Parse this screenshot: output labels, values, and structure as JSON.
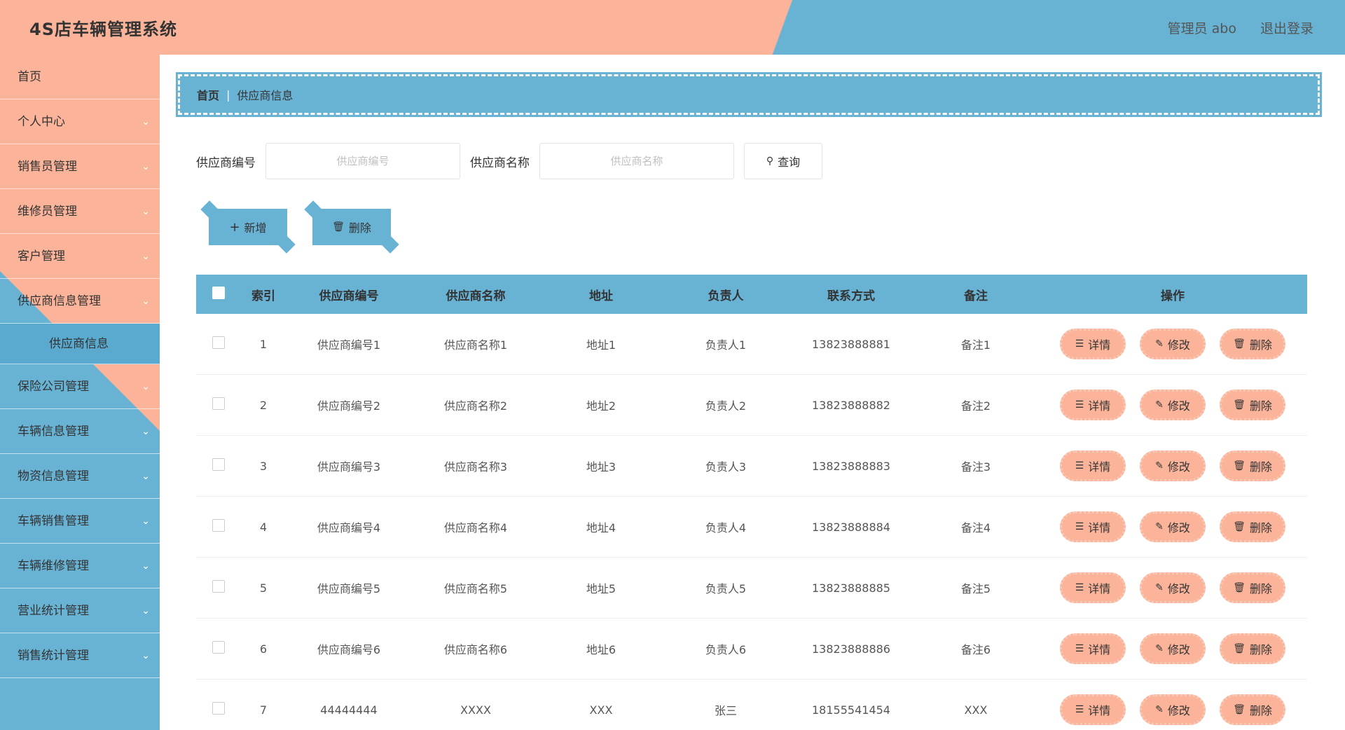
{
  "header": {
    "title": "4S店车辆管理系统",
    "admin": "管理员 abo",
    "logout": "退出登录"
  },
  "sidebar": {
    "items": [
      {
        "label": "首页",
        "chevron": false
      },
      {
        "label": "个人中心",
        "chevron": true
      },
      {
        "label": "销售员管理",
        "chevron": true
      },
      {
        "label": "维修员管理",
        "chevron": true
      },
      {
        "label": "客户管理",
        "chevron": true
      },
      {
        "label": "供应商信息管理",
        "chevron": true
      },
      {
        "label": "供应商信息",
        "chevron": false,
        "sub": true
      },
      {
        "label": "保险公司管理",
        "chevron": true
      },
      {
        "label": "车辆信息管理",
        "chevron": true
      },
      {
        "label": "物资信息管理",
        "chevron": true
      },
      {
        "label": "车辆销售管理",
        "chevron": true
      },
      {
        "label": "车辆维修管理",
        "chevron": true
      },
      {
        "label": "营业统计管理",
        "chevron": true
      },
      {
        "label": "销售统计管理",
        "chevron": true
      }
    ]
  },
  "breadcrumb": {
    "home": "首页",
    "sep": "|",
    "current": "供应商信息"
  },
  "search": {
    "no_label": "供应商编号",
    "no_placeholder": "供应商编号",
    "name_label": "供应商名称",
    "name_placeholder": "供应商名称",
    "query_label": "查询",
    "query_icon": "search-icon"
  },
  "actions": {
    "add_label": "新增",
    "delete_label": "删除"
  },
  "table": {
    "headers": [
      "索引",
      "供应商编号",
      "供应商名称",
      "地址",
      "负责人",
      "联系方式",
      "备注",
      "操作"
    ],
    "ops": {
      "detail": "详情",
      "edit": "修改",
      "delete": "删除"
    },
    "rows": [
      {
        "idx": "1",
        "no": "供应商编号1",
        "name": "供应商名称1",
        "addr": "地址1",
        "man": "负责人1",
        "tel": "13823888881",
        "note": "备注1"
      },
      {
        "idx": "2",
        "no": "供应商编号2",
        "name": "供应商名称2",
        "addr": "地址2",
        "man": "负责人2",
        "tel": "13823888882",
        "note": "备注2"
      },
      {
        "idx": "3",
        "no": "供应商编号3",
        "name": "供应商名称3",
        "addr": "地址3",
        "man": "负责人3",
        "tel": "13823888883",
        "note": "备注3"
      },
      {
        "idx": "4",
        "no": "供应商编号4",
        "name": "供应商名称4",
        "addr": "地址4",
        "man": "负责人4",
        "tel": "13823888884",
        "note": "备注4"
      },
      {
        "idx": "5",
        "no": "供应商编号5",
        "name": "供应商名称5",
        "addr": "地址5",
        "man": "负责人5",
        "tel": "13823888885",
        "note": "备注5"
      },
      {
        "idx": "6",
        "no": "供应商编号6",
        "name": "供应商名称6",
        "addr": "地址6",
        "man": "负责人6",
        "tel": "13823888886",
        "note": "备注6"
      },
      {
        "idx": "7",
        "no": "44444444",
        "name": "XXXX",
        "addr": "XXX",
        "man": "张三",
        "tel": "18155541454",
        "note": "XXX"
      }
    ]
  },
  "colors": {
    "peach": "#fbb49a",
    "blue": "#68b2d4"
  }
}
